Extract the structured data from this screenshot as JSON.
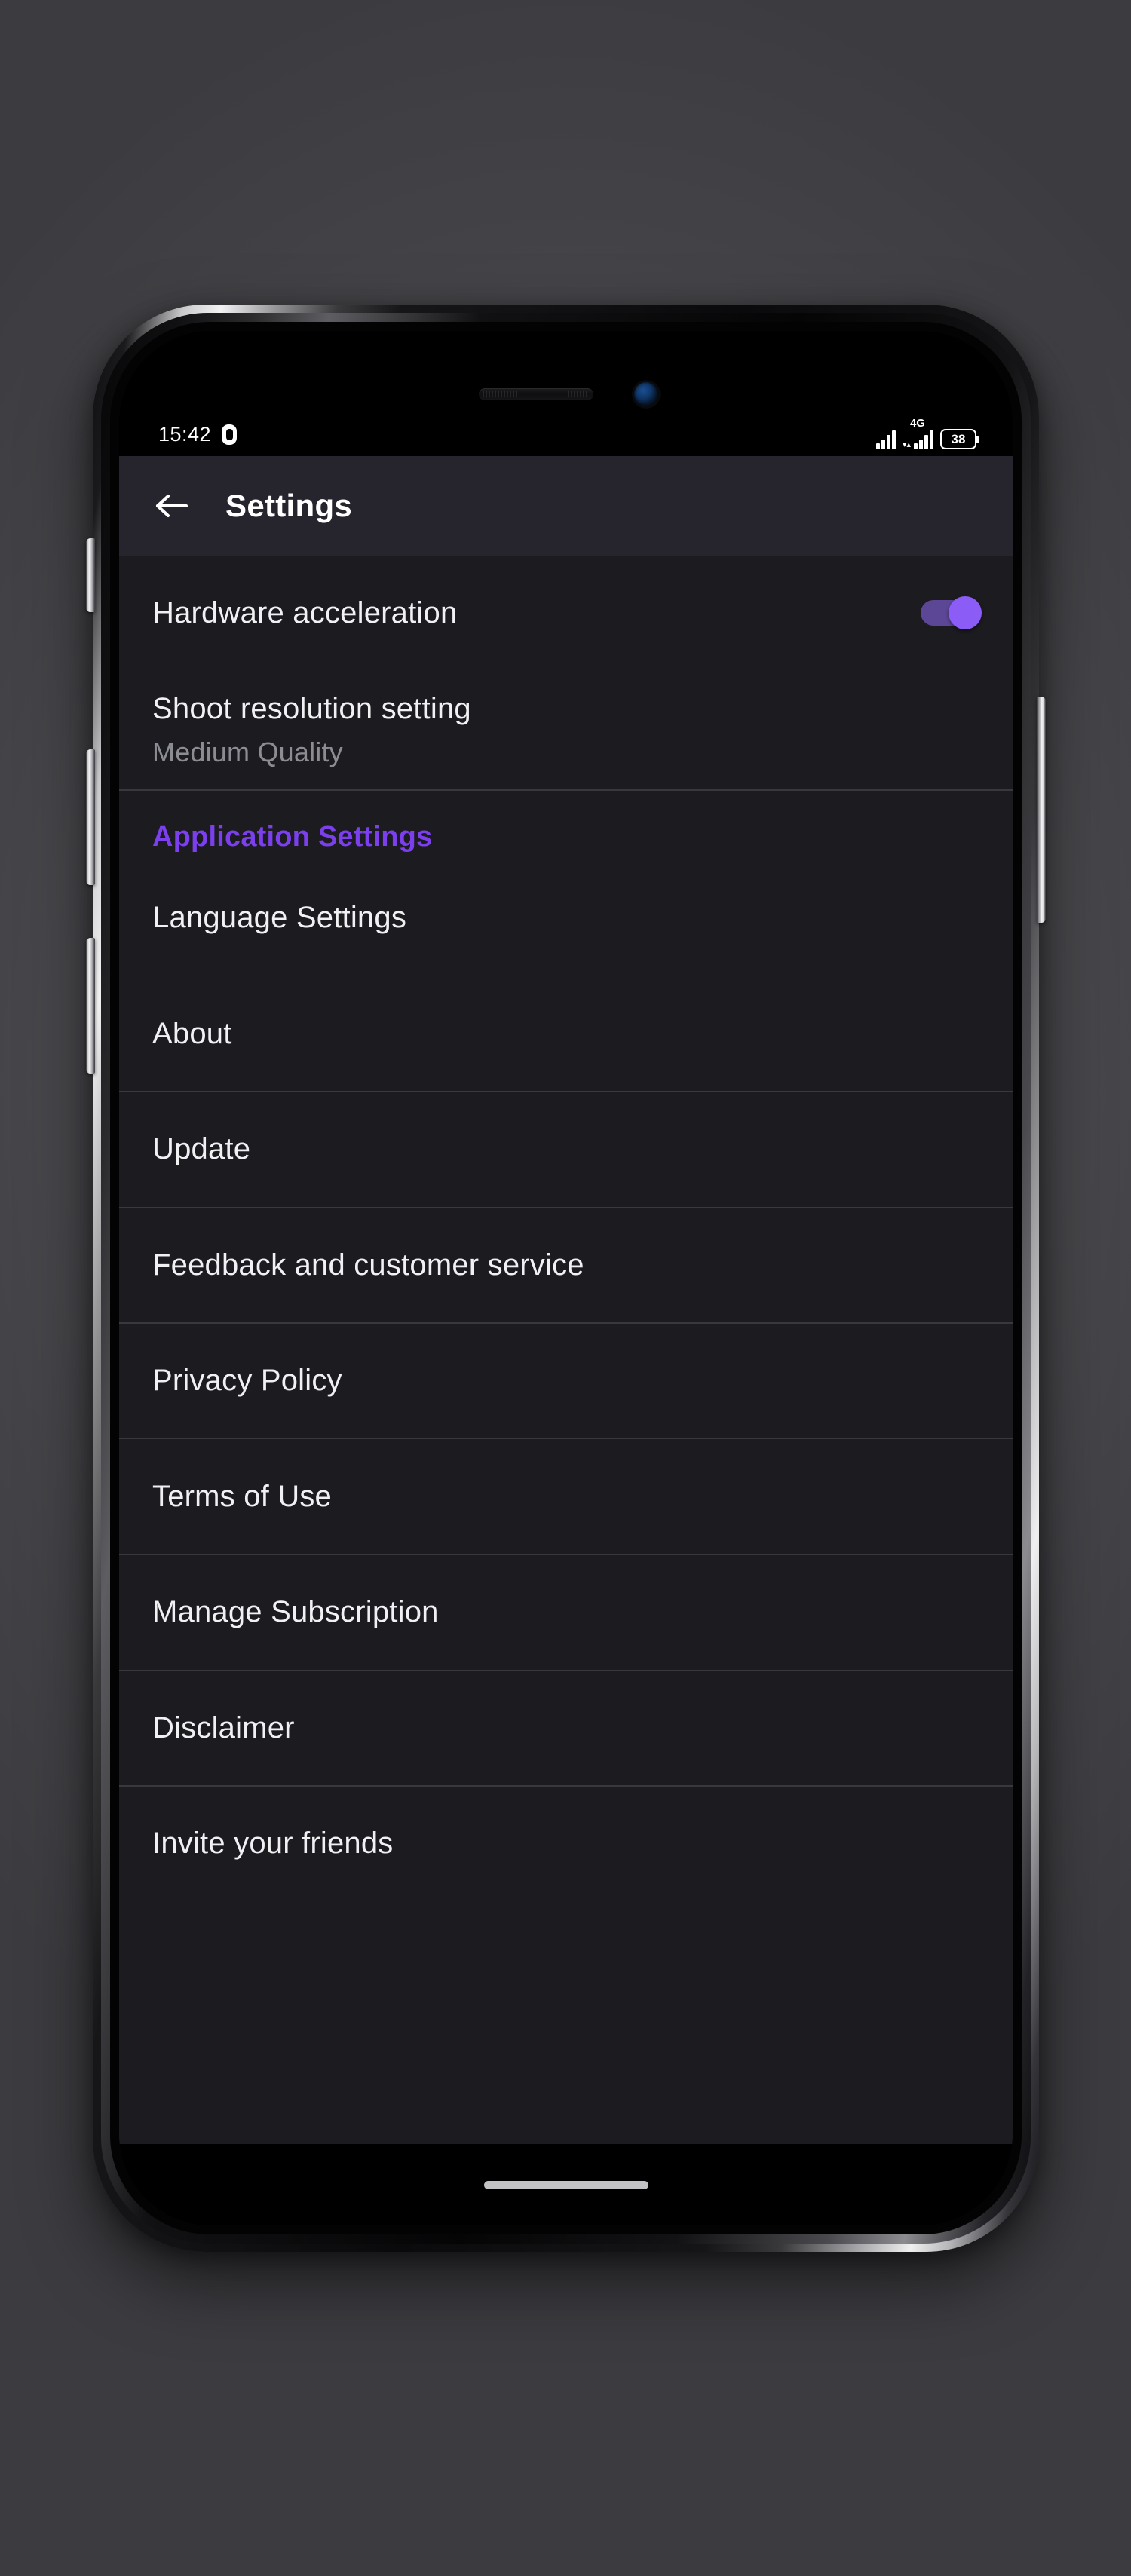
{
  "status_bar": {
    "time": "15:42",
    "indicator_icon": "capsule-icon",
    "network_type": "4G",
    "signal_icon": "signal-bars-icon",
    "battery_level": "38"
  },
  "app_bar": {
    "back_icon": "back-arrow-icon",
    "title": "Settings"
  },
  "settings": {
    "hardware_acceleration": {
      "label": "Hardware acceleration",
      "toggle_state": "on"
    },
    "shoot_resolution": {
      "label": "Shoot resolution setting",
      "value": "Medium Quality"
    },
    "section_header": "Application Settings",
    "items": [
      {
        "label": "Language Settings"
      },
      {
        "label": "About"
      },
      {
        "label": "Update"
      },
      {
        "label": "Feedback and customer service"
      },
      {
        "label": "Privacy Policy"
      },
      {
        "label": "Terms of Use"
      },
      {
        "label": "Manage Subscription"
      },
      {
        "label": "Disclaimer"
      },
      {
        "label": "Invite your friends"
      }
    ]
  },
  "colors": {
    "accent_purple": "#7c3fee",
    "switch_thumb": "#8b5cf6",
    "switch_track": "#5c4796",
    "app_background": "#1b1b20",
    "appbar_background": "#26252e",
    "divider": "#38383f",
    "primary_text": "#f1f1f3",
    "secondary_text": "#8c8c93"
  },
  "home_indicator": "home-indicator-bar"
}
